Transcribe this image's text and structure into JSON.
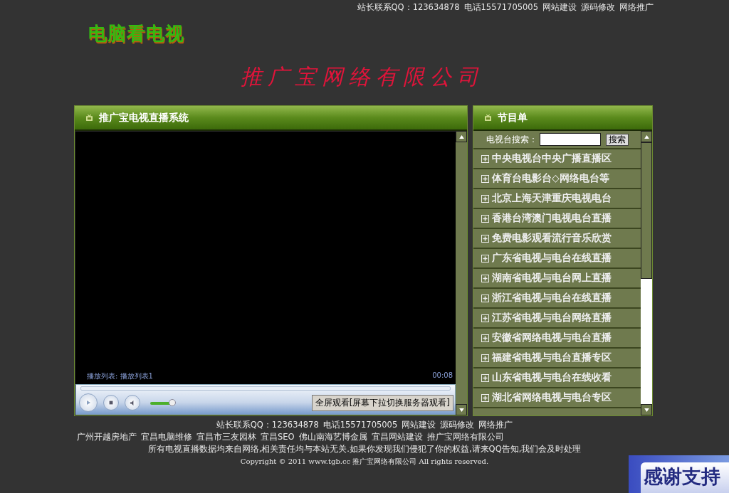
{
  "top_links": [
    "站长联系QQ：123634878",
    "电话15571705005",
    "网站建设",
    "源码修改",
    "网络推广"
  ],
  "logo": "电脑看电视",
  "company_banner": "推广宝网络有限公司",
  "player_panel": {
    "title": "推广宝电视直播系统",
    "playlist_label": "播放列表: 播放列表1",
    "time": "00:08",
    "volume": {
      "level": 0.55
    },
    "fullscreen_button": "全屏观看[屏幕下拉切换服务器观看]"
  },
  "program_panel": {
    "title": "节目单",
    "search_label": "电视台搜索：",
    "search_button": "搜索",
    "items": [
      {
        "label": "中央电视台中央广播直播区",
        "expanded": false
      },
      {
        "label": "体育台电影台◇网络电台等",
        "expanded": false
      },
      {
        "label": "北京上海天津重庆电视电台",
        "expanded": false
      },
      {
        "label": "香港台湾澳门电视电台直播",
        "expanded": false
      },
      {
        "label": "免费电影观看流行音乐欣赏",
        "expanded": false
      },
      {
        "label": "广东省电视与电台在线直播",
        "expanded": false
      },
      {
        "label": "湖南省电视与电台网上直播",
        "expanded": false
      },
      {
        "label": "浙江省电视与电台在线直播",
        "expanded": false
      },
      {
        "label": "江苏省电视与电台网络直播",
        "expanded": false
      },
      {
        "label": "安徽省网络电视与电台直播",
        "expanded": false
      },
      {
        "label": "福建省电视与电台直播专区",
        "expanded": false
      },
      {
        "label": "山东省电视与电台在线收看",
        "expanded": false
      },
      {
        "label": "湖北省网络电视与电台专区",
        "expanded": false
      }
    ]
  },
  "footer": {
    "links": [
      "站长联系QQ：123634878",
      "电话15571705005",
      "网站建设",
      "源码修改",
      "网络推广"
    ],
    "friend_links": [
      "广州开越房地产",
      "宜昌电脑维修",
      "宜昌市三友园林",
      "宜昌SEO",
      "佛山南海艺博金属",
      "宜昌网站建设",
      "推广宝网络有限公司"
    ],
    "disclaimer": "所有电视直播数据均来自网络,相关责任均与本站无关.如果你发现我们侵犯了你的权益,请来QQ告知,我们会及时处理",
    "copyright": "Copyright © 2011 www.tgb.cc 推广宝网络有限公司 All rights reserved."
  },
  "thanks_badge": "感谢支持"
}
